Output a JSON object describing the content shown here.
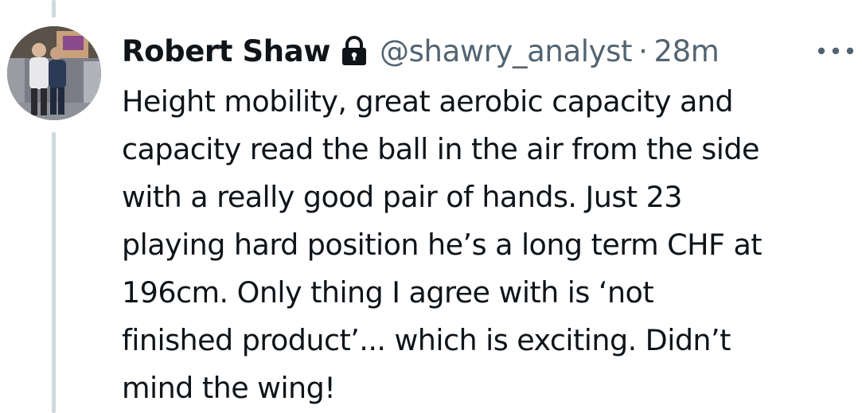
{
  "tweet": {
    "author": {
      "display_name": "Robert Shaw",
      "handle": "@shawry_analyst",
      "avatar_icon": "profile-photo",
      "verified_icon": "lock-icon"
    },
    "separator": "·",
    "timestamp": "28m",
    "more_icon": "more-horizontal-icon",
    "text_lines": [
      "Height mobility, great aerobic capacity and",
      "capacity read the ball in the air from the side",
      "with a really good pair of hands. Just 23",
      "playing hard position he’s a long term CHF at",
      "196cm. Only thing I agree with is ‘not",
      "finished product’... which is exciting. Didn’t",
      "mind the wing!"
    ]
  },
  "colors": {
    "primary_text": "#0f1419",
    "secondary_text": "#536471",
    "thread_line": "#cfd9de"
  }
}
